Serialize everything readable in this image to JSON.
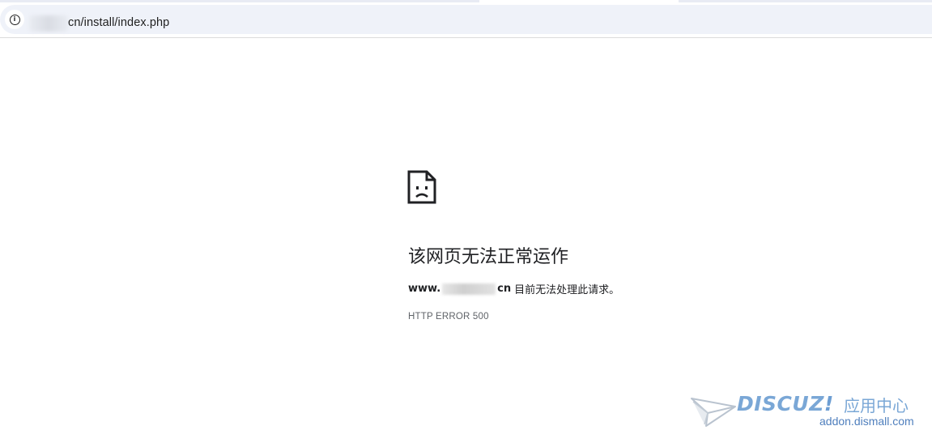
{
  "browser": {
    "address_bar": {
      "url_visible": "cn/install/index.php",
      "site_info_icon": "info-circle-icon"
    }
  },
  "error_page": {
    "icon": "sad-page-icon",
    "title": "该网页无法正常运作",
    "host_prefix": "www.",
    "host_suffix": "cn",
    "message": "目前无法处理此请求。",
    "code": "HTTP ERROR 500"
  },
  "watermark": {
    "brand": "DISCUZ",
    "brand_mark": "!",
    "tagline": "应用中心",
    "domain": "addon.dismall.com",
    "icon": "paper-plane-icon"
  },
  "colors": {
    "address_bar_bg": "#eff2f9",
    "text_primary": "#202124",
    "text_secondary": "#5f6368",
    "watermark_blue": "#7aa7d6"
  }
}
